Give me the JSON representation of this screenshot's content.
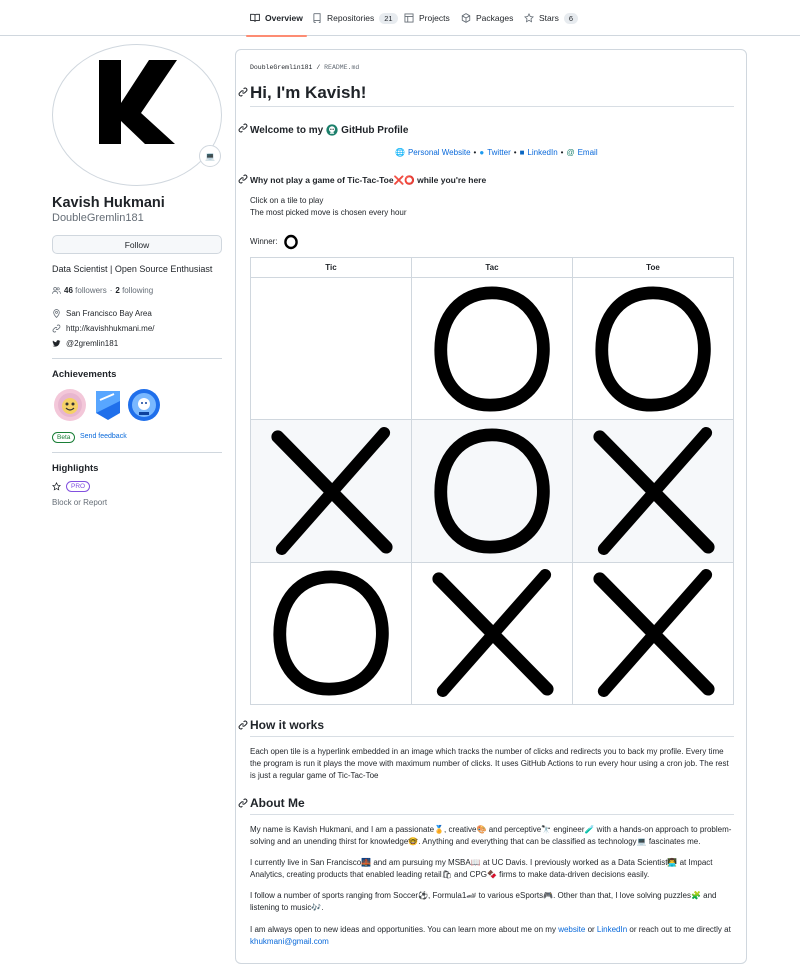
{
  "nav": {
    "tabs": [
      {
        "label": "Overview",
        "active": true,
        "icon": "book-icon"
      },
      {
        "label": "Repositories",
        "count": "21",
        "icon": "repo-icon"
      },
      {
        "label": "Projects",
        "icon": "table-icon"
      },
      {
        "label": "Packages",
        "icon": "package-icon"
      },
      {
        "label": "Stars",
        "count": "6",
        "icon": "star-icon"
      }
    ]
  },
  "profile": {
    "fullname": "Kavish Hukmani",
    "username": "DoubleGremlin181",
    "follow_label": "Follow",
    "bio": "Data Scientist | Open Source Enthusiast",
    "followers_count": "46",
    "followers_label": "followers",
    "following_count": "2",
    "following_label": "following",
    "location": "San Francisco Bay Area",
    "website": "http://kavishhukmani.me/",
    "twitter": "@2gremlin181",
    "status_emoji": "💻"
  },
  "achievements": {
    "heading": "Achievements",
    "beta_label": "Beta",
    "feedback_label": "Send feedback"
  },
  "highlights": {
    "heading": "Highlights",
    "pro_label": "PRO",
    "block_label": "Block or Report"
  },
  "readme": {
    "crumb_user": "DoubleGremlin181",
    "crumb_sep": "/",
    "crumb_file": "README.md",
    "title": "Hi, I'm Kavish!",
    "welcome_pre": "Welcome to my",
    "welcome_post": "GitHub Profile",
    "links": {
      "website": "Personal Website",
      "twitter": "Twitter",
      "linkedin": "LinkedIn",
      "email": "Email",
      "sep": "•"
    },
    "game_heading": "Why not play a game of Tic-Tac-Toe❌⭕ while you're here",
    "click_line": "Click on a tile to play",
    "picked_line": "The most picked move is chosen every hour",
    "winner_label": "Winner:",
    "winner_symbol": "O",
    "board": {
      "headers": [
        "Tic",
        "Tac",
        "Toe"
      ],
      "cells": [
        [
          "",
          "O",
          "O"
        ],
        [
          "X",
          "O",
          "X"
        ],
        [
          "O",
          "X",
          "X"
        ]
      ]
    },
    "how_heading": "How it works",
    "how_lines": [
      "Each open tile is a hyperlink embedded in an image which tracks the number of clicks and redirects you to back my profile. Every time",
      "the program is run it plays the move with maximum number of clicks. It uses GitHub Actions to run every hour using a cron job. The rest",
      "is just a regular game of Tic-Tac-Toe"
    ],
    "about_heading": "About Me",
    "about_p1": [
      "My name is Kavish Hukmani, and I am a passionate🏅, creative🎨 and perceptive🔭 engineer🧪 with a hands-on approach to problem-",
      "solving and an unending thirst for knowledge🤓. Anything and everything that can be classified as technology💻 fascinates me."
    ],
    "about_p2": [
      "I currently live in San Francisco🌉 and am pursuing my MSBA📖 at UC Davis. I previously worked as a Data Scientist👨‍💻 at Impact",
      "Analytics, creating products that enabled leading retail🛍 and CPG🍫 firms to make data-driven decisions easily."
    ],
    "about_p3": [
      "I follow a number of sports ranging from Soccer⚽, Formula1🏎 to various eSports🎮. Other than that, I love solving puzzles🧩 and",
      "listening to music🎶."
    ],
    "about_p4_pre": "I am always open to new ideas and opportunities. You can learn more about me on my",
    "about_p4_website": "website",
    "about_p4_or": "or",
    "about_p4_linkedin": "LinkedIn",
    "about_p4_post": "or reach out to me directly at",
    "about_p4_email": "khukmani@gmail.com"
  }
}
